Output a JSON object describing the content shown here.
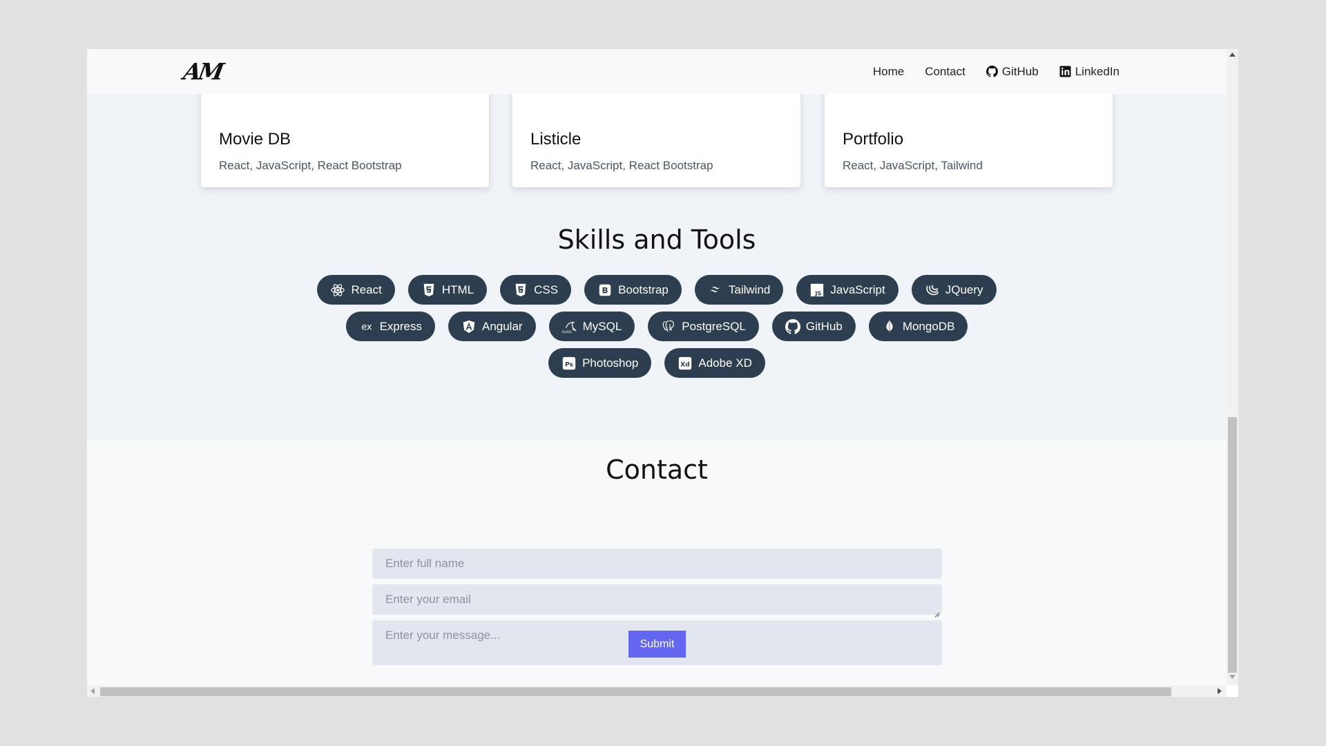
{
  "navbar": {
    "logo": "AM",
    "links": [
      {
        "label": "Home",
        "icon": ""
      },
      {
        "label": "Contact",
        "icon": ""
      },
      {
        "label": "GitHub",
        "icon": "github-icon"
      },
      {
        "label": "LinkedIn",
        "icon": "linkedin-icon"
      }
    ]
  },
  "projects": [
    {
      "title": "Movie DB",
      "tags": "React, JavaScript, React Bootstrap"
    },
    {
      "title": "Listicle",
      "tags": "React, JavaScript, React Bootstrap"
    },
    {
      "title": "Portfolio",
      "tags": "React, JavaScript, Tailwind"
    }
  ],
  "skills": {
    "title": "Skills and Tools",
    "items": [
      {
        "label": "React",
        "icon": "react-icon"
      },
      {
        "label": "HTML",
        "icon": "html5-icon"
      },
      {
        "label": "CSS",
        "icon": "css3-icon"
      },
      {
        "label": "Bootstrap",
        "icon": "bootstrap-icon"
      },
      {
        "label": "Tailwind",
        "icon": "tailwind-icon"
      },
      {
        "label": "JavaScript",
        "icon": "javascript-icon"
      },
      {
        "label": "JQuery",
        "icon": "jquery-icon"
      },
      {
        "label": "Express",
        "icon": "express-icon"
      },
      {
        "label": "Angular",
        "icon": "angular-icon"
      },
      {
        "label": "MySQL",
        "icon": "mysql-icon"
      },
      {
        "label": "PostgreSQL",
        "icon": "postgresql-icon"
      },
      {
        "label": "GitHub",
        "icon": "github-icon"
      },
      {
        "label": "MongoDB",
        "icon": "mongodb-icon"
      },
      {
        "label": "Photoshop",
        "icon": "photoshop-icon"
      },
      {
        "label": "Adobe XD",
        "icon": "adobe-xd-icon"
      }
    ]
  },
  "contact": {
    "title": "Contact",
    "name_placeholder": "Enter full name",
    "email_placeholder": "Enter your email",
    "message_placeholder": "Enter your message...",
    "submit_label": "Submit"
  },
  "colors": {
    "pill_bg": "#2c3e50",
    "accent": "#6366f1",
    "page_bg": "#f0f3f8"
  }
}
